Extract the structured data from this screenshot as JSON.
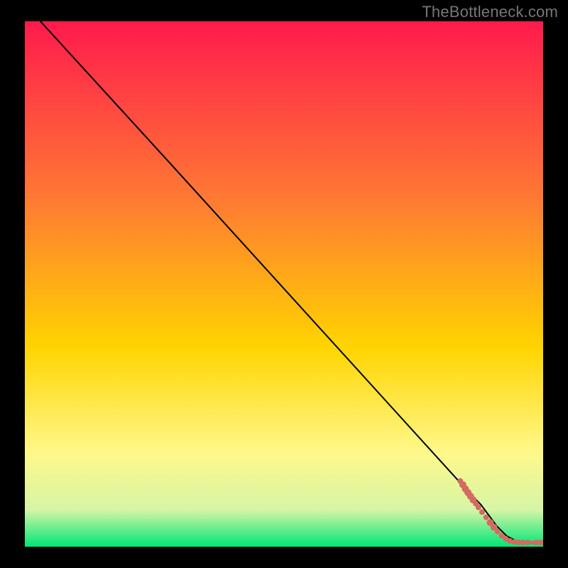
{
  "watermark": "TheBottleneck.com",
  "colors": {
    "line": "#000000",
    "marker": "#d46a61",
    "bg_top": "#ff1a4d",
    "bg_mid1": "#ff7a33",
    "bg_mid2": "#ffd400",
    "bg_mid3": "#fff88a",
    "bg_mid4": "#d6f5a6",
    "bg_bot": "#00e676"
  },
  "chart_data": {
    "type": "line",
    "title": "",
    "xlabel": "",
    "ylabel": "",
    "xlim": [
      0,
      100
    ],
    "ylim": [
      0,
      100
    ],
    "series": [
      {
        "name": "bottleneck-curve",
        "x": [
          3,
          28,
          86,
          88,
          91,
          93,
          95,
          97,
          99,
          100
        ],
        "y": [
          100,
          73,
          10,
          8,
          4,
          2,
          1,
          0.7,
          0.6,
          0.6
        ]
      }
    ],
    "markers": {
      "name": "data-points",
      "points": [
        {
          "x": 84.0,
          "y": 12.5,
          "r": 4
        },
        {
          "x": 84.5,
          "y": 11.8,
          "r": 5
        },
        {
          "x": 85.0,
          "y": 11.0,
          "r": 5
        },
        {
          "x": 85.5,
          "y": 10.3,
          "r": 5
        },
        {
          "x": 86.0,
          "y": 9.6,
          "r": 5
        },
        {
          "x": 86.5,
          "y": 8.9,
          "r": 5
        },
        {
          "x": 87.0,
          "y": 8.2,
          "r": 4
        },
        {
          "x": 87.5,
          "y": 7.5,
          "r": 4
        },
        {
          "x": 88.2,
          "y": 6.6,
          "r": 4
        },
        {
          "x": 89.0,
          "y": 5.6,
          "r": 4
        },
        {
          "x": 89.8,
          "y": 4.6,
          "r": 5
        },
        {
          "x": 90.5,
          "y": 3.7,
          "r": 5
        },
        {
          "x": 91.2,
          "y": 2.9,
          "r": 4
        },
        {
          "x": 92.0,
          "y": 2.1,
          "r": 4
        },
        {
          "x": 92.8,
          "y": 1.5,
          "r": 4
        },
        {
          "x": 93.6,
          "y": 1.1,
          "r": 4
        },
        {
          "x": 94.5,
          "y": 0.9,
          "r": 4
        },
        {
          "x": 95.3,
          "y": 0.8,
          "r": 4
        },
        {
          "x": 96.1,
          "y": 0.8,
          "r": 4
        },
        {
          "x": 97.0,
          "y": 0.8,
          "r": 4
        },
        {
          "x": 97.8,
          "y": 0.8,
          "r": 3
        },
        {
          "x": 98.6,
          "y": 0.8,
          "r": 4
        },
        {
          "x": 99.4,
          "y": 0.8,
          "r": 4
        },
        {
          "x": 100.0,
          "y": 0.8,
          "r": 4
        }
      ]
    }
  }
}
